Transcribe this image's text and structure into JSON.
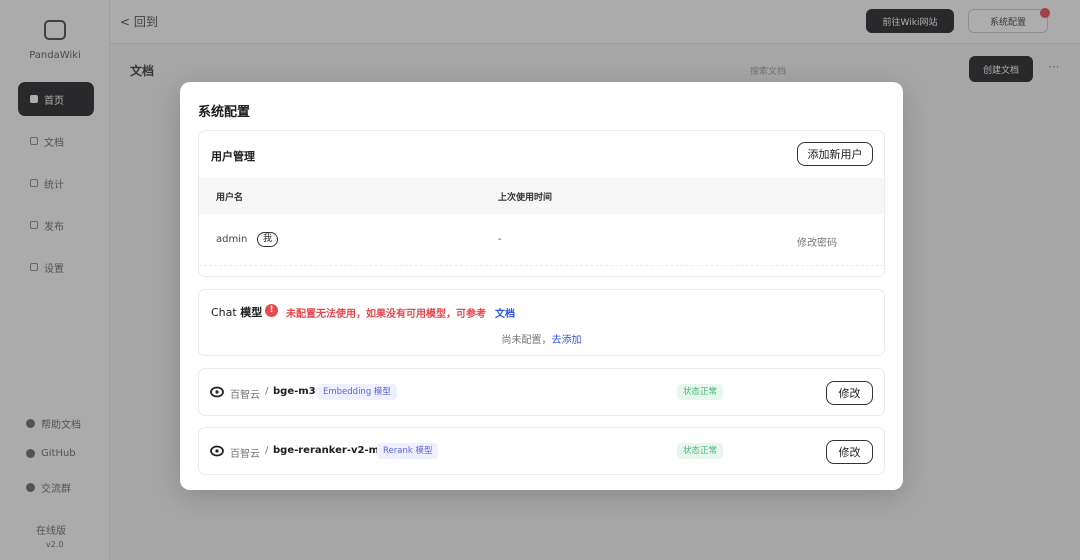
{
  "background": {
    "sidebar": {
      "logo_text": "PandaWiki",
      "items": [
        {
          "label": "首页"
        },
        {
          "label": "文档"
        },
        {
          "label": "统计"
        },
        {
          "label": "发布"
        },
        {
          "label": "设置"
        }
      ],
      "bottom_items": [
        {
          "label": "帮助文档"
        },
        {
          "label": "GitHub"
        },
        {
          "label": "交流群"
        },
        {
          "label": "在线版"
        }
      ],
      "version": "v2.0"
    },
    "topbar": {
      "back_label": "< 回到",
      "primary_button": "前往Wiki网站",
      "system_button": "系统配置"
    },
    "content": {
      "title": "文档",
      "muted_text": "搜索文档",
      "create_button": "创建文档",
      "more": "···"
    }
  },
  "modal": {
    "title": "系统配置",
    "users": {
      "title": "用户管理",
      "add_button": "添加新用户",
      "columns": [
        "用户名",
        "上次使用时间"
      ],
      "rows": [
        {
          "username": "admin",
          "tag": "我",
          "last_used": "-",
          "action": "修改密码"
        }
      ]
    },
    "chat_model": {
      "title_prefix": "Chat",
      "title_main": "模型",
      "warning_icon": "!",
      "warning_text": "未配置无法使用，如果没有可用模型，可参考",
      "warning_link": "文档",
      "empty_text": "尚未配置，",
      "empty_link": "去添加"
    },
    "models": [
      {
        "provider": "百智云",
        "separator": "/",
        "name": "bge-m3",
        "type_tag": "Embedding 模型",
        "status": "状态正常",
        "edit_button": "修改"
      },
      {
        "provider": "百智云",
        "separator": "/",
        "name": "bge-reranker-v2-m3",
        "type_tag": "Rerank 模型",
        "status": "状态正常",
        "edit_button": "修改"
      }
    ]
  },
  "colors": {
    "danger": "#e5484d",
    "link": "#2f54eb",
    "success": "#46b478",
    "tag_purple": "#5b64d6",
    "dark": "#1d1d1f"
  },
  "icons": {
    "warning": "warning-circle-icon",
    "provider": "baizhi-cloud-icon"
  }
}
